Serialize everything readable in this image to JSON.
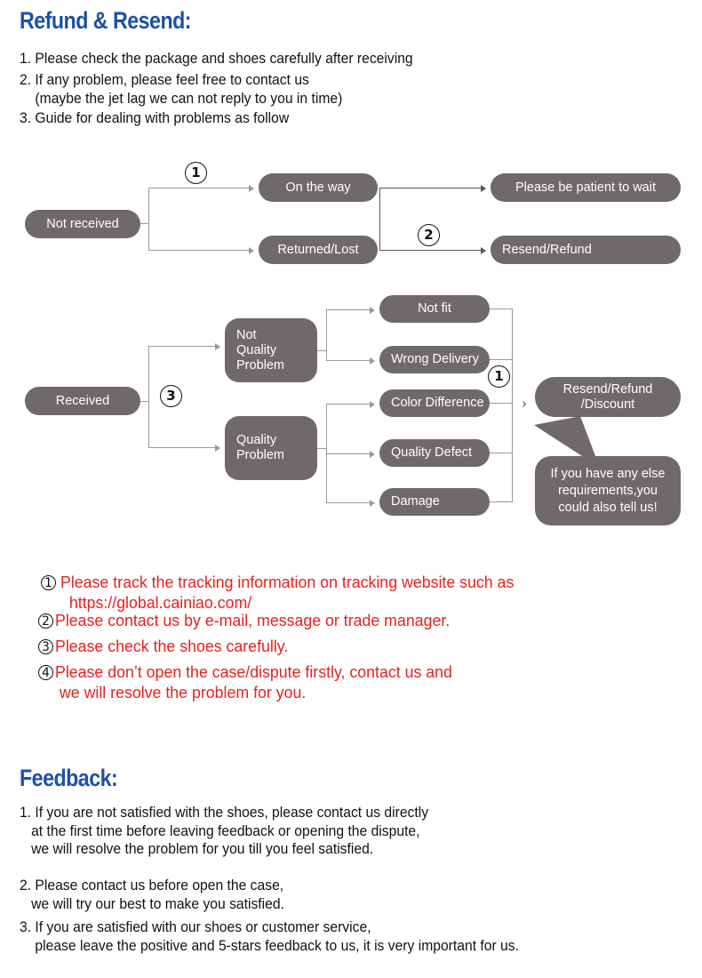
{
  "colors": {
    "heading_blue": "#1d51a6",
    "node_gray": "#6f696c",
    "red": "#e8201c",
    "connector": "#9a9a9a",
    "text_black": "#121212"
  },
  "refund_section": {
    "title": "Refund & Resend:",
    "items": [
      "1. Please check the package and shoes carefully after receiving",
      "2. If any problem, please feel free to contact us\n    (maybe the jet lag we can not reply to you in time)",
      "3. Guide for dealing with problems as follow"
    ]
  },
  "flowchart_not_received": {
    "start": "Not received",
    "marker_1": "1",
    "marker_2": "2",
    "branches": [
      {
        "status": "On the way",
        "outcome": "Please be patient to wait"
      },
      {
        "status": "Returned/Lost",
        "outcome": "Resend/Refund"
      }
    ]
  },
  "flowchart_received": {
    "start": "Received",
    "marker_3": "3",
    "marker_1": "1",
    "categories": [
      {
        "name": "Not\nQuality\nProblem",
        "reasons": [
          "Not fit",
          "Wrong Delivery"
        ]
      },
      {
        "name": "Quality\nProblem",
        "reasons": [
          "Color Difference",
          "Quality Defect",
          "Damage"
        ]
      }
    ],
    "outcome": "Resend/Refund\n/Discount",
    "bubble": "If you have any else\nrequirements,you\ncould also tell us!"
  },
  "red_notes": [
    {
      "num": "1",
      "text": "Please track the tracking information on tracking website such as\n  https://global.cainiao.com/"
    },
    {
      "num": "2",
      "text": "Please contact us by e-mail, message or trade manager."
    },
    {
      "num": "3",
      "text": "Please check the shoes carefully."
    },
    {
      "num": "4",
      "text": "Please don’t open the case/dispute firstly, contact us and\n we will resolve the problem for you."
    }
  ],
  "feedback_section": {
    "title": "Feedback:",
    "items": [
      "1. If you are not satisfied with the shoes, please contact us directly\n   at the first time before leaving feedback or opening the dispute,\n   we will resolve the problem for you till you feel satisfied.",
      "2. Please contact us before open the case,\n   we will try our best to make you satisfied.",
      "3. If you are satisfied with our shoes or customer service,\n    please leave the positive and 5-stars feedback to us, it is very important for us."
    ]
  }
}
